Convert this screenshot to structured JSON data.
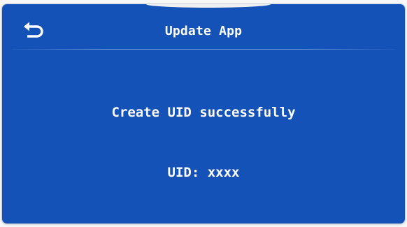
{
  "header": {
    "title": "Update App",
    "back_icon": "back-arrow-icon"
  },
  "main": {
    "message": "Create UID successfully",
    "uid_text": "UID: xxxx"
  },
  "colors": {
    "background": "#1452b8",
    "text": "#ffffff"
  }
}
